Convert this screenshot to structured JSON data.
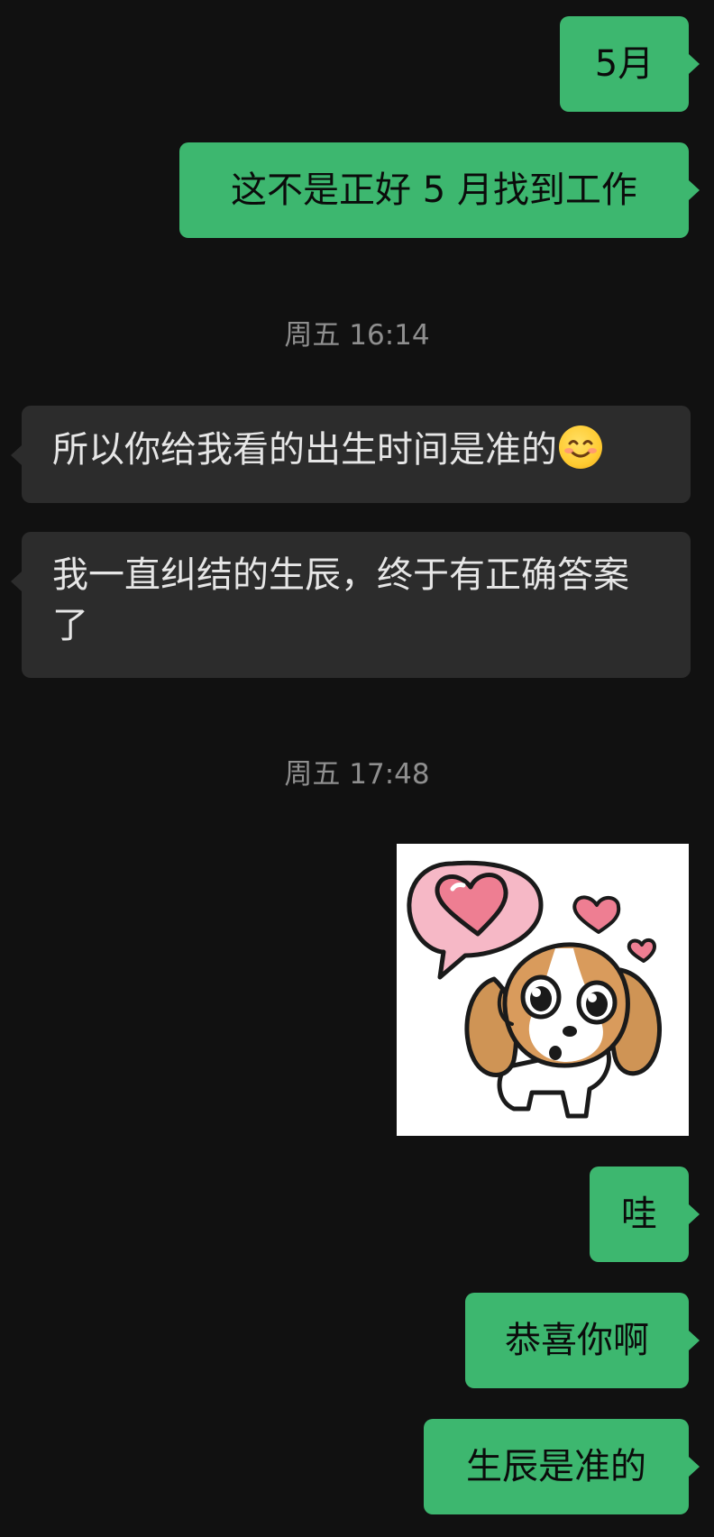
{
  "messages": [
    {
      "side": "out",
      "text": "5月"
    },
    {
      "side": "out",
      "text": "这不是正好 5 月找到工作"
    },
    {
      "type": "time",
      "text": "周五 16:14"
    },
    {
      "side": "in",
      "text": "所以你给我看的出生时间是准的",
      "emoji": "smiling-face-emoji"
    },
    {
      "side": "in",
      "text": "我一直纠结的生辰，终于有正确答案了"
    },
    {
      "type": "time",
      "text": "周五 17:48"
    },
    {
      "side": "out",
      "type": "sticker",
      "sticker": "puppy-with-hearts-sticker"
    },
    {
      "side": "out",
      "text": "哇"
    },
    {
      "side": "out",
      "text": "恭喜你啊"
    },
    {
      "side": "out",
      "text": "生辰是准的"
    }
  ],
  "colors": {
    "background": "#111111",
    "outgoing_bubble": "#3db76f",
    "incoming_bubble": "#2c2c2c",
    "timestamp_text": "#8f8f8f"
  }
}
